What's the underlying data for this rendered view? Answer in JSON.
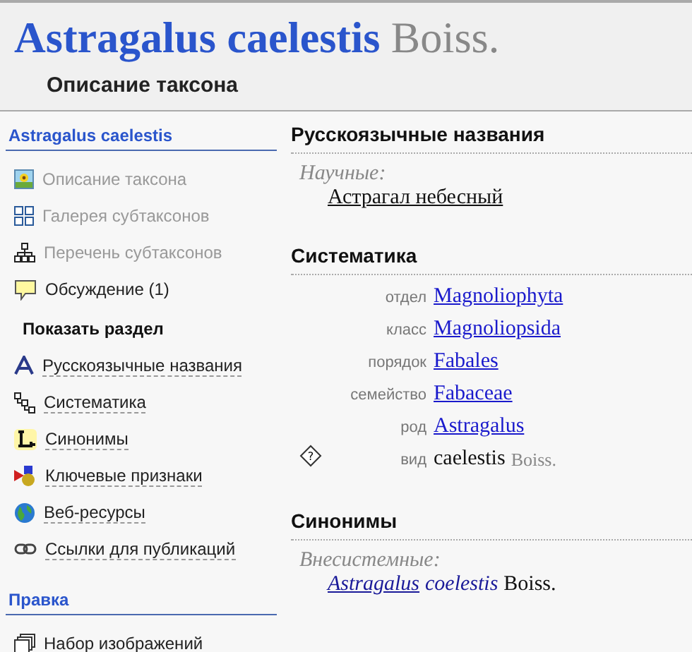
{
  "header": {
    "title": "Astragalus caelestis",
    "author": "Boiss.",
    "subtitle": "Описание таксона"
  },
  "sidebar": {
    "title": "Astragalus caelestis",
    "items": [
      {
        "label": "Описание таксона",
        "kind": "picture",
        "disabled": true
      },
      {
        "label": "Галерея субтаксонов",
        "kind": "grid",
        "disabled": true
      },
      {
        "label": "Перечень субтаксонов",
        "kind": "tree",
        "disabled": true
      },
      {
        "label": "Обсуждение (1)",
        "kind": "comment",
        "disabled": false
      }
    ],
    "sections_title": "Показать раздел",
    "sections": [
      {
        "label": "Русскоязычные названия",
        "kind": "letter-a"
      },
      {
        "label": "Систематика",
        "kind": "hierarchy"
      },
      {
        "label": "Синонимы",
        "kind": "letter-l"
      },
      {
        "label": "Ключевые признаки",
        "kind": "shapes"
      },
      {
        "label": "Веб-ресурсы",
        "kind": "globe"
      },
      {
        "label": "Ссылки для публикаций",
        "kind": "chain"
      }
    ],
    "edit_title": "Правка",
    "edit_items": [
      {
        "label": "Набор изображений",
        "kind": "images"
      }
    ]
  },
  "names": {
    "title": "Русскоязычные названия",
    "group": "Научные:",
    "name": "Астрагал небесный"
  },
  "systematics": {
    "title": "Систематика",
    "rows": [
      {
        "rank": "отдел",
        "name": "Magnoliophyta",
        "kind": "link"
      },
      {
        "rank": "класс",
        "name": "Magnoliopsida",
        "kind": "link"
      },
      {
        "rank": "порядок",
        "name": "Fabales",
        "kind": "link"
      },
      {
        "rank": "семейство",
        "name": "Fabaceae",
        "kind": "link"
      },
      {
        "rank": "род",
        "name": "Astragalus",
        "kind": "link"
      },
      {
        "rank": "вид",
        "name": "caelestis",
        "author": "Boiss.",
        "kind": "current",
        "help_mark": "?"
      }
    ]
  },
  "synonyms": {
    "title": "Синонимы",
    "group": "Внесистемные:",
    "genus": "Astragalus",
    "epithet": "coelestis",
    "author": "Boiss."
  }
}
